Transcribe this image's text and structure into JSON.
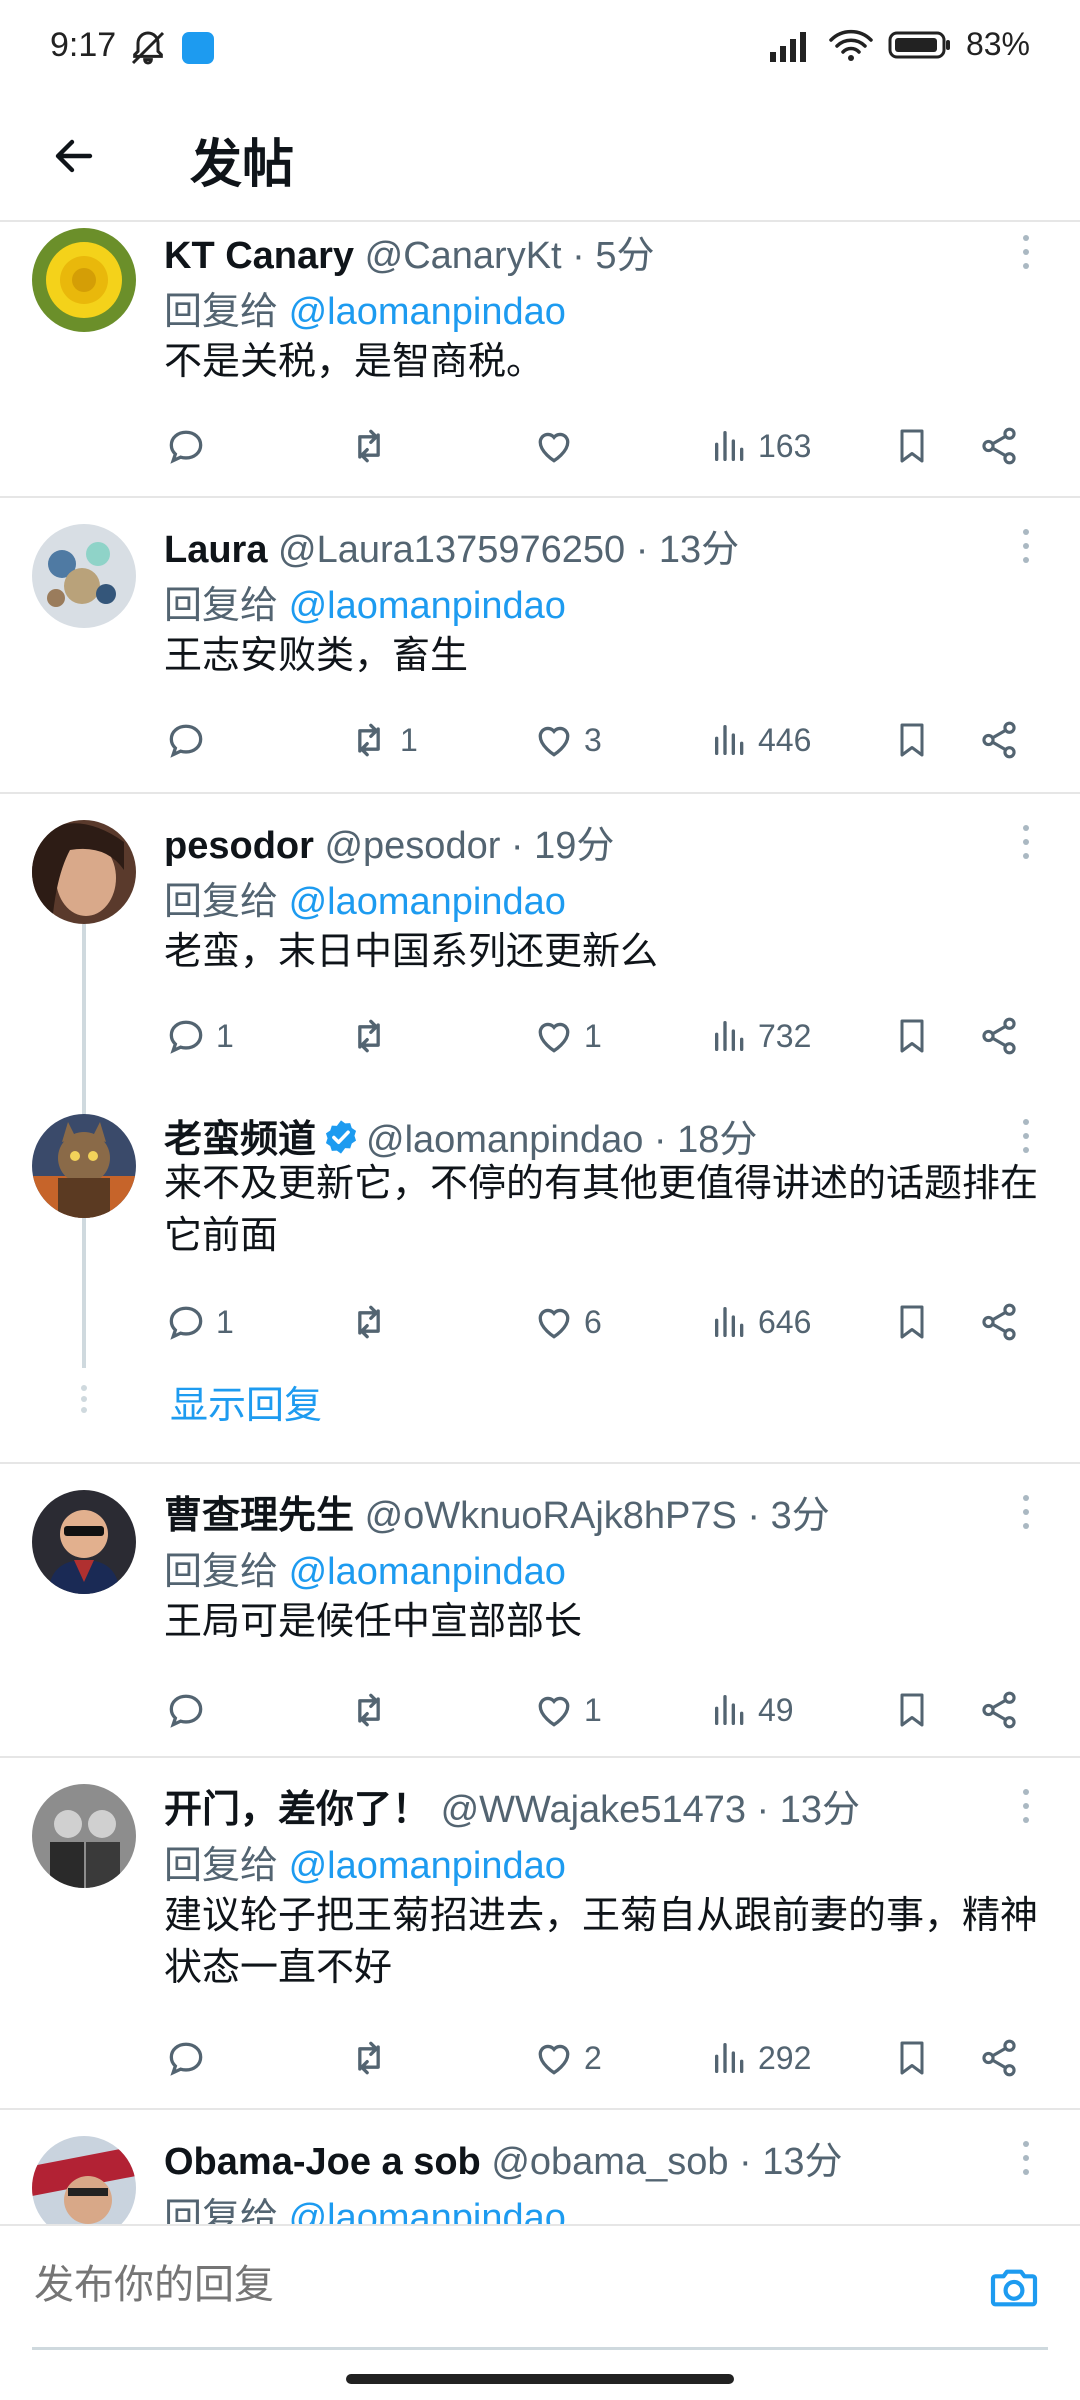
{
  "status_bar": {
    "time": "9:17",
    "battery": "83%"
  },
  "header": {
    "title": "发帖"
  },
  "tweets": [
    {
      "name": "KT Canary",
      "meta": "@CanaryKt · 5分",
      "reply_prefix": "回复给",
      "reply_handle": "@laomanpindao",
      "text": "不是关税，是智商税。",
      "replies": "",
      "retweets": "",
      "likes": "",
      "views": "163"
    },
    {
      "name": "Laura",
      "meta": "@Laura1375976250 · 13分",
      "reply_prefix": "回复给",
      "reply_handle": "@laomanpindao",
      "text": "王志安败类，畜生",
      "replies": "",
      "retweets": "1",
      "likes": "3",
      "views": "446"
    },
    {
      "name": "pesodor",
      "meta": "@pesodor · 19分",
      "reply_prefix": "回复给",
      "reply_handle": "@laomanpindao",
      "text": "老蛮，末日中国系列还更新么",
      "replies": "1",
      "retweets": "",
      "likes": "1",
      "views": "732"
    },
    {
      "name": "老蛮频道",
      "meta": "@laomanpindao · 18分",
      "text": "来不及更新它，不停的有其他更值得讲述的话题排在它前面",
      "replies": "1",
      "retweets": "",
      "likes": "6",
      "views": "646"
    },
    {
      "name": "曹查理先生",
      "meta": "@oWknuoRAjk8hP7S · 3分",
      "reply_prefix": "回复给",
      "reply_handle": "@laomanpindao",
      "text": "王局可是候任中宣部部长",
      "replies": "",
      "retweets": "",
      "likes": "1",
      "views": "49"
    },
    {
      "name": "开门，差你了！",
      "meta": "@WWajake51473 · 13分",
      "reply_prefix": "回复给",
      "reply_handle": "@laomanpindao",
      "text": "建议轮子把王菊招进去，王菊自从跟前妻的事，精神状态一直不好",
      "replies": "",
      "retweets": "",
      "likes": "2",
      "views": "292"
    },
    {
      "name": "Obama-Joe a sob",
      "meta": "@obama_sob · 13分",
      "reply_prefix": "回复给",
      "reply_handle": "@laomanpindao"
    }
  ],
  "show_replies": "显示回复",
  "reply_bar": {
    "placeholder": "发布你的回复"
  },
  "colors": {
    "accent": "#1d9bf0",
    "secondary_text": "#536471",
    "divider": "#e6e6e6"
  },
  "icons": [
    "back-arrow-icon",
    "reply-icon",
    "retweet-icon",
    "like-icon",
    "views-icon",
    "bookmark-icon",
    "share-icon",
    "more-icon",
    "verified-icon",
    "camera-icon"
  ]
}
